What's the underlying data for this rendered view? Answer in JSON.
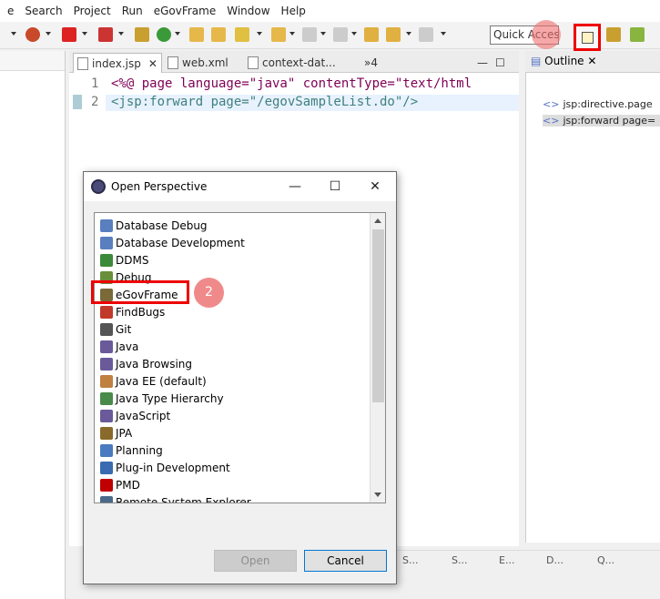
{
  "menu": [
    "e",
    "Search",
    "Project",
    "Run",
    "eGovFrame",
    "Window",
    "Help"
  ],
  "toolbar": {
    "quick_access": "Quick Access"
  },
  "editor": {
    "tabs": [
      "index.jsp",
      "web.xml",
      "context-dat...",
      "»4"
    ],
    "lines": [
      {
        "num": "1",
        "text": "<%@ page language=\"java\" contentType=\"text/html"
      },
      {
        "num": "2",
        "text": "<jsp:forward page=\"/egovSampleList.do\"/>"
      }
    ]
  },
  "outline": {
    "title": "Outline",
    "items": [
      "jsp:directive.page",
      "jsp:forward page="
    ]
  },
  "bottom": {
    "tabs": [
      "S...",
      "S...",
      "E...",
      "D...",
      "Q..."
    ]
  },
  "dialog": {
    "title": "Open Perspective",
    "marker": "2",
    "perspectives": [
      {
        "label": "Database Debug",
        "icon": "database-debug-icon",
        "color": "#5a7fbf"
      },
      {
        "label": "Database Development",
        "icon": "database-dev-icon",
        "color": "#5a7fbf"
      },
      {
        "label": "DDMS",
        "icon": "ddms-icon",
        "color": "#3b8a3b"
      },
      {
        "label": "Debug",
        "icon": "debug-icon",
        "color": "#6a8f3a"
      },
      {
        "label": "eGovFrame",
        "icon": "egovframe-icon",
        "color": "#7a6a3a"
      },
      {
        "label": "FindBugs",
        "icon": "findbugs-icon",
        "color": "#c0392b"
      },
      {
        "label": "Git",
        "icon": "git-icon",
        "color": "#555555"
      },
      {
        "label": "Java",
        "icon": "java-icon",
        "color": "#6a5a9a"
      },
      {
        "label": "Java Browsing",
        "icon": "java-browsing-icon",
        "color": "#6a5a9a"
      },
      {
        "label": "Java EE (default)",
        "icon": "javaee-icon",
        "color": "#c08040"
      },
      {
        "label": "Java Type Hierarchy",
        "icon": "type-hierarchy-icon",
        "color": "#4a8a4a"
      },
      {
        "label": "JavaScript",
        "icon": "javascript-icon",
        "color": "#6a5a9a"
      },
      {
        "label": "JPA",
        "icon": "jpa-icon",
        "color": "#8a6a2a"
      },
      {
        "label": "Planning",
        "icon": "planning-icon",
        "color": "#4a7abf"
      },
      {
        "label": "Plug-in Development",
        "icon": "plugin-icon",
        "color": "#3a6ab0"
      },
      {
        "label": "PMD",
        "icon": "pmd-icon",
        "color": "#c00000"
      },
      {
        "label": "Remote System Explorer",
        "icon": "rse-icon",
        "color": "#4a6a8a"
      }
    ],
    "buttons": {
      "open": "Open",
      "cancel": "Cancel"
    }
  }
}
